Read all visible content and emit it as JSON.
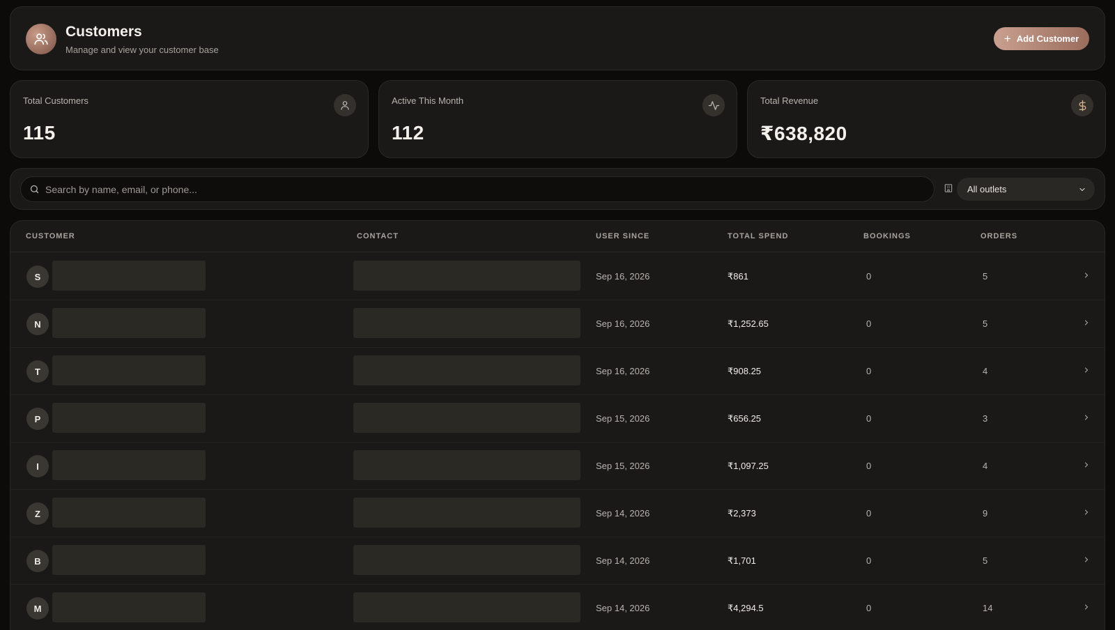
{
  "header": {
    "title": "Customers",
    "subtitle": "Manage and view your customer base",
    "add_button": "Add Customer",
    "add_icon": "+"
  },
  "stats": [
    {
      "label": "Total Customers",
      "value": "115",
      "icon": "user-icon"
    },
    {
      "label": "Active This Month",
      "value": "112",
      "icon": "activity-icon"
    },
    {
      "label": "Total Revenue",
      "value": "₹638,820",
      "icon": "dollar-icon"
    }
  ],
  "filters": {
    "search_placeholder": "Search by name, email, or phone...",
    "outlet_select": "All outlets"
  },
  "table": {
    "columns": [
      "CUSTOMER",
      "CONTACT",
      "USER SINCE",
      "TOTAL SPEND",
      "BOOKINGS",
      "ORDERS"
    ],
    "rows": [
      {
        "initial": "S",
        "since": "Sep 16, 2026",
        "spend": "₹861",
        "bookings": "0",
        "orders": "5"
      },
      {
        "initial": "N",
        "since": "Sep 16, 2026",
        "spend": "₹1,252.65",
        "bookings": "0",
        "orders": "5"
      },
      {
        "initial": "T",
        "since": "Sep 16, 2026",
        "spend": "₹908.25",
        "bookings": "0",
        "orders": "4"
      },
      {
        "initial": "P",
        "since": "Sep 15, 2026",
        "spend": "₹656.25",
        "bookings": "0",
        "orders": "3"
      },
      {
        "initial": "I",
        "since": "Sep 15, 2026",
        "spend": "₹1,097.25",
        "bookings": "0",
        "orders": "4"
      },
      {
        "initial": "Z",
        "since": "Sep 14, 2026",
        "spend": "₹2,373",
        "bookings": "0",
        "orders": "9"
      },
      {
        "initial": "B",
        "since": "Sep 14, 2026",
        "spend": "₹1,701",
        "bookings": "0",
        "orders": "5"
      },
      {
        "initial": "M",
        "since": "Sep 14, 2026",
        "spend": "₹4,294.5",
        "bookings": "0",
        "orders": "14"
      }
    ]
  },
  "colors": {
    "background": "#0c0b0a",
    "card": "#1a1917",
    "accent_start": "#c9a090",
    "accent_end": "#9a6c5c",
    "revenue_icon": "#d8b38a"
  }
}
